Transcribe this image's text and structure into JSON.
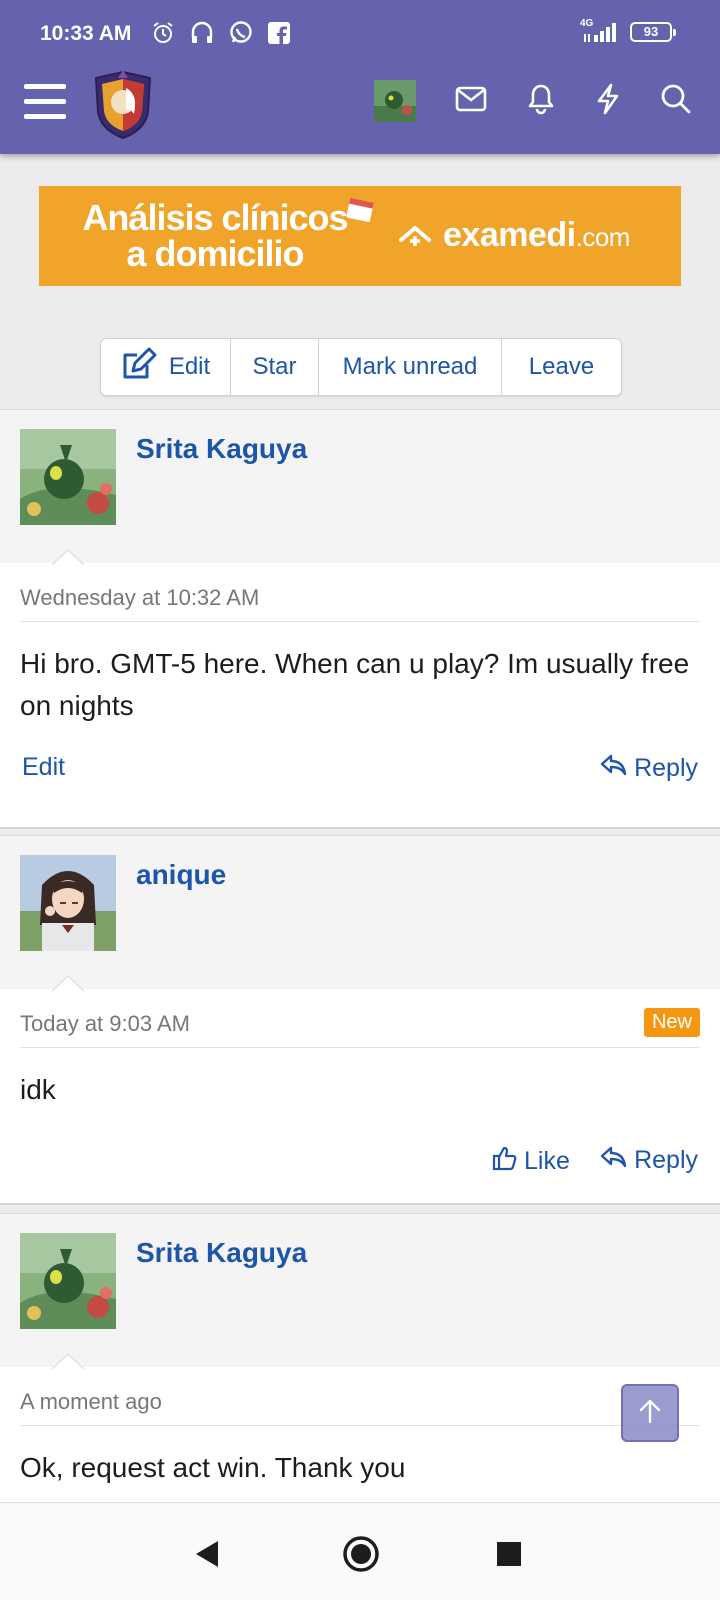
{
  "status_bar": {
    "time": "10:33 AM",
    "network": "4G",
    "battery": "93",
    "icons": [
      "alarm-icon",
      "headset-icon",
      "whatsapp-icon",
      "facebook-icon",
      "signal-icon",
      "battery-icon"
    ]
  },
  "header": {
    "icons": [
      "menu-icon",
      "site-logo",
      "user-avatar",
      "mail-icon",
      "bell-icon",
      "bolt-icon",
      "search-icon"
    ]
  },
  "ad": {
    "line1": "Análisis clínicos",
    "line2": "a domicilio",
    "brand": "examedi",
    "brand_suffix": ".com"
  },
  "actions": {
    "edit": "Edit",
    "star": "Star",
    "mark_unread": "Mark unread",
    "leave": "Leave"
  },
  "messages": [
    {
      "author": "Srita Kaguya",
      "date": "Wednesday at 10:32 AM",
      "text": "Hi bro. GMT-5 here. When can u play? Im usually free on nights",
      "edit_label": "Edit",
      "reply_label": "Reply"
    },
    {
      "author": "anique",
      "date": "Today at 9:03 AM",
      "badge": "New",
      "text": "idk",
      "like_label": "Like",
      "reply_label": "Reply"
    },
    {
      "author": "Srita Kaguya",
      "date": "A moment ago",
      "text": "Ok, request act win. Thank you"
    }
  ],
  "colors": {
    "header_bg": "#6563ad",
    "link": "#1d55a8",
    "ad_bg": "#f0a42a",
    "new_badge": "#f59610"
  }
}
